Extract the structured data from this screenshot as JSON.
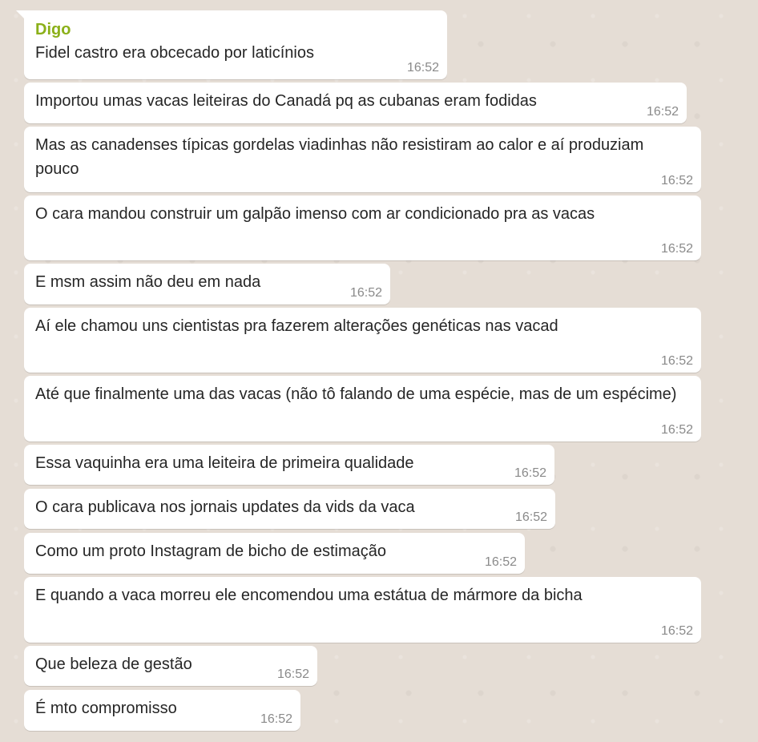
{
  "sender": "Digo",
  "messages": [
    {
      "text": "Fidel castro era obcecado por laticínios",
      "time": "16:52"
    },
    {
      "text": "Importou umas vacas leiteiras do Canadá pq as cubanas eram fodidas",
      "time": "16:52"
    },
    {
      "text": "Mas as canadenses típicas gordelas viadinhas não resistiram ao calor e aí produziam pouco",
      "time": "16:52"
    },
    {
      "text": "O cara mandou construir um galpão imenso com ar condicionado pra as vacas",
      "time": "16:52"
    },
    {
      "text": "E msm assim não deu em nada",
      "time": "16:52"
    },
    {
      "text": "Aí ele chamou uns cientistas pra fazerem alterações genéticas nas vacad",
      "time": "16:52"
    },
    {
      "text": "Até que finalmente uma das vacas (não tô falando de uma espécie, mas de um espécime)",
      "time": "16:52"
    },
    {
      "text": "Essa vaquinha era uma leiteira de primeira qualidade",
      "time": "16:52"
    },
    {
      "text": "O cara publicava nos jornais updates da vids da vaca",
      "time": "16:52"
    },
    {
      "text": "Como um proto Instagram de bicho de estimação",
      "time": "16:52"
    },
    {
      "text": "E quando a vaca morreu ele encomendou uma estátua de mármore da bicha",
      "time": "16:52"
    },
    {
      "text": "Que beleza de gestão",
      "time": "16:52"
    },
    {
      "text": "É mto compromisso",
      "time": "16:52"
    }
  ]
}
